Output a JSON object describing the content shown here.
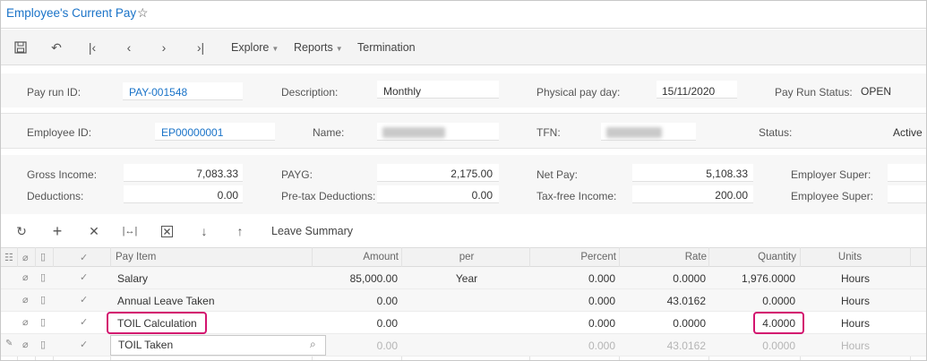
{
  "header": {
    "title": "Employee's Current Pay"
  },
  "toolbar": {
    "icons": [
      "save-icon",
      "undo-icon",
      "first-icon",
      "prev-icon",
      "next-icon",
      "last-icon"
    ],
    "explore": "Explore",
    "reports": "Reports",
    "termination": "Termination"
  },
  "pay_run": {
    "id_label": "Pay run ID:",
    "id_value": "PAY-001548",
    "desc_label": "Description:",
    "desc_value": "Monthly",
    "payday_label": "Physical pay day:",
    "payday_value": "15/11/2020",
    "status_label": "Pay Run Status:",
    "status_value": "OPEN"
  },
  "employee": {
    "id_label": "Employee ID:",
    "id_value": "EP00000001",
    "name_label": "Name:",
    "tfn_label": "TFN:",
    "status_label": "Status:",
    "status_value": "Active"
  },
  "totals": {
    "gross_label": "Gross Income:",
    "gross_value": "7,083.33",
    "deductions_label": "Deductions:",
    "deductions_value": "0.00",
    "payg_label": "PAYG:",
    "payg_value": "2,175.00",
    "pretax_label": "Pre-tax Deductions:",
    "pretax_value": "0.00",
    "net_label": "Net Pay:",
    "net_value": "5,108.33",
    "taxfree_label": "Tax-free Income:",
    "taxfree_value": "200.00",
    "employer_super_label": "Employer Super:",
    "employee_super_label": "Employee Super:"
  },
  "grid_toolbar": {
    "leave_summary": "Leave Summary"
  },
  "grid": {
    "columns": [
      "Pay Item",
      "Amount",
      "per",
      "Percent",
      "Rate",
      "Quantity",
      "Units"
    ],
    "rows": [
      {
        "item": "Salary",
        "amount": "85,000.00",
        "per": "Year",
        "percent": "0.000",
        "rate": "0.0000",
        "quantity": "1,976.0000",
        "units": "Hours"
      },
      {
        "item": "Annual Leave Taken",
        "amount": "0.00",
        "per": "",
        "percent": "0.000",
        "rate": "43.0162",
        "quantity": "0.0000",
        "units": "Hours"
      },
      {
        "item": "TOIL Calculation",
        "amount": "0.00",
        "per": "",
        "percent": "0.000",
        "rate": "0.0000",
        "quantity": "4.0000",
        "units": "Hours"
      },
      {
        "item": "TOIL Taken",
        "amount": "0.00",
        "per": "",
        "percent": "0.000",
        "rate": "43.0162",
        "quantity": "0.0000",
        "units": "Hours"
      }
    ]
  },
  "colors": {
    "accent": "#1a73c8",
    "highlight": "#d3146f"
  }
}
